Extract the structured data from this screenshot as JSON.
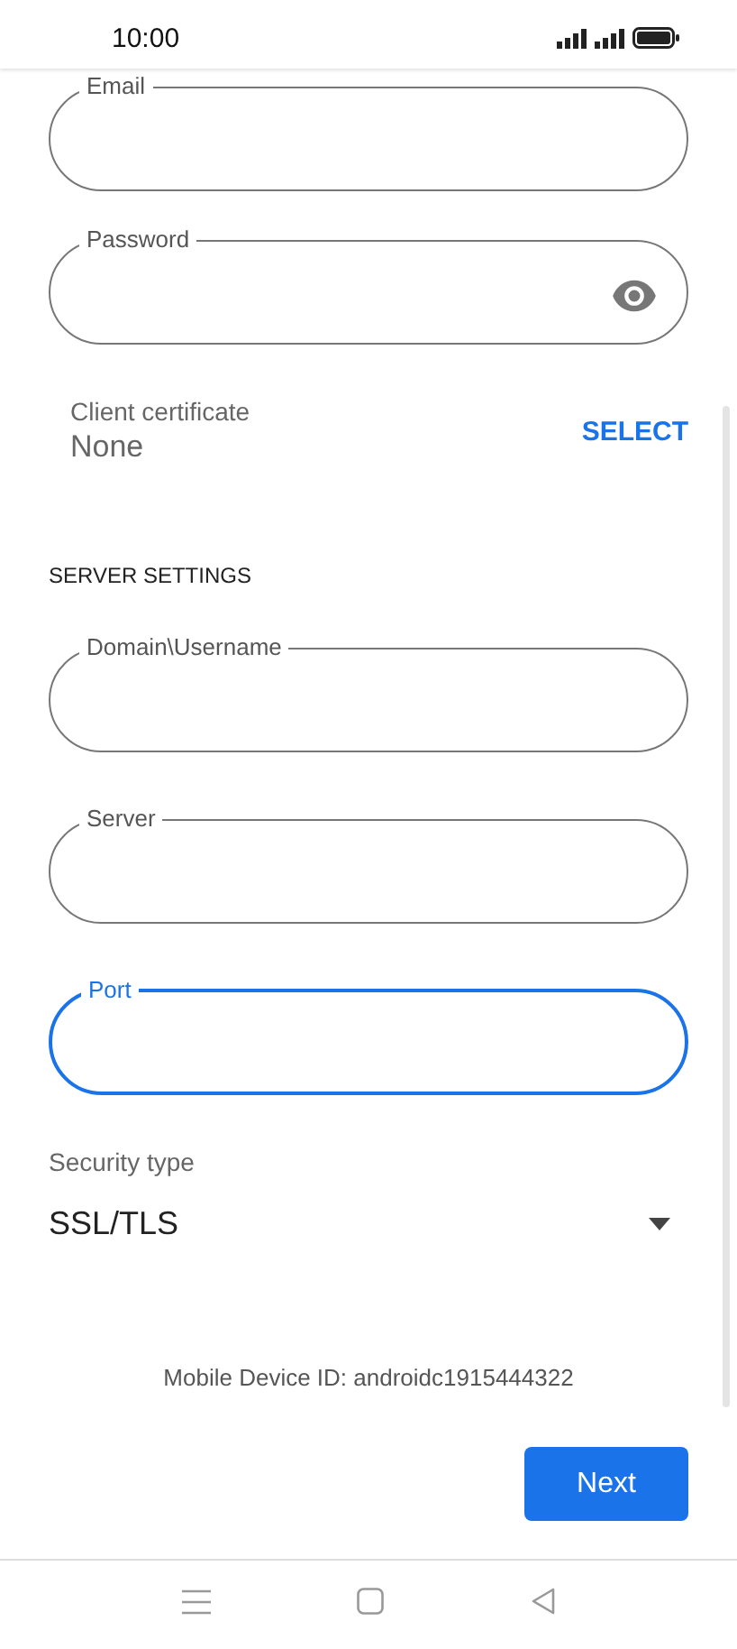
{
  "status_bar": {
    "time": "10:00"
  },
  "account_fields": [
    {
      "label": "Email",
      "visibility_toggle": false,
      "focused": false
    },
    {
      "label": "Password",
      "visibility_toggle": true,
      "focused": false
    }
  ],
  "client_certificate": {
    "label": "Client certificate",
    "value": "None",
    "action": "SELECT"
  },
  "server_settings": {
    "heading": "SERVER SETTINGS",
    "fields": [
      {
        "label": "Domain\\Username",
        "visibility_toggle": false,
        "focused": false
      },
      {
        "label": "Server",
        "visibility_toggle": false,
        "focused": false
      },
      {
        "label": "Port",
        "visibility_toggle": false,
        "focused": true
      }
    ]
  },
  "security_type": {
    "label": "Security type",
    "value": "SSL/TLS"
  },
  "device_id": "Mobile Device ID: androidc1915444322",
  "next_button": "Next"
}
